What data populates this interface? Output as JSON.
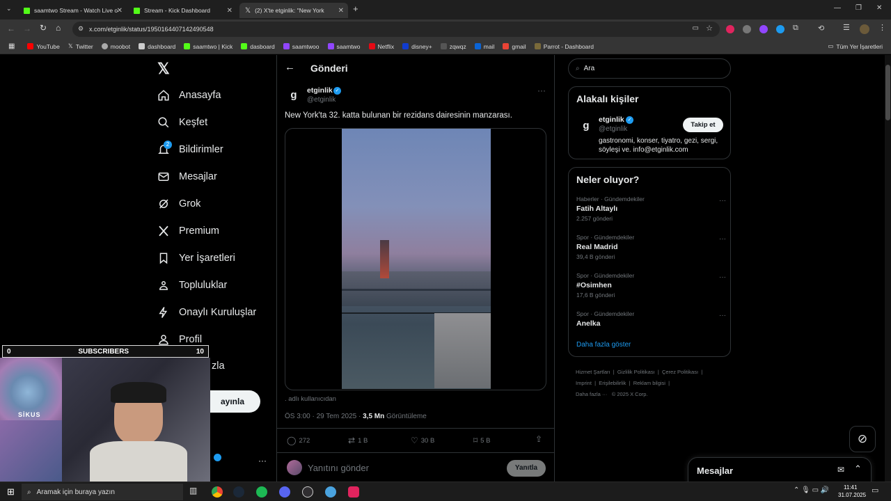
{
  "browser": {
    "tabs": [
      {
        "label": "saamtwo Stream - Watch Live o"
      },
      {
        "label": "Stream - Kick Dashboard"
      },
      {
        "label": "(2) X'te etginlik: \"New York"
      }
    ],
    "url": "x.com/etginlik/status/1950164407142490548",
    "bookmarks": [
      "YouTube",
      "Twitter",
      "moobot",
      "dashboard",
      "saamtwo | Kick",
      "dasboard",
      "saamtwoo",
      "saamtwo",
      "Netflix",
      "disney+",
      "zqwqz",
      "mail",
      "gmail",
      "Parrot - Dashboard"
    ],
    "all_bookmarks": "Tüm Yer İşaretleri"
  },
  "nav": {
    "items": [
      "Anasayfa",
      "Keşfet",
      "Bildirimler",
      "Mesajlar",
      "Grok",
      "Premium",
      "Yer İşaretleri",
      "Topluluklar",
      "Onaylı Kuruluşlar",
      "Profil",
      "zla"
    ],
    "notification_count": "2",
    "post_button": "ayınla"
  },
  "post": {
    "header_title": "Gönderi",
    "author_name": "etginlik",
    "author_handle": "@etginlik",
    "text": "New York'ta 32. katta bulunan bir rezidans dairesinin manzarası.",
    "source_note": ". adlı kullanıcıdan",
    "time": "ÖS 3:00 · 29 Tem 2025 · ",
    "views_count": "3,5 Mn",
    "views_label": " Görüntüleme",
    "replies": "272",
    "reposts": "1 B",
    "likes": "30 B",
    "bookmarks": "5 B",
    "reply_placeholder": "Yanıtını gönder",
    "reply_button": "Yanıtla"
  },
  "right": {
    "search_placeholder": "Ara",
    "related_title": "Alakalı kişiler",
    "related": {
      "name": "etginlik",
      "handle": "@etginlik",
      "bio": "gastronomi, konser, tiyatro, gezi, sergi, söyleşi ve. info@etginlik.com",
      "follow": "Takip et"
    },
    "trends_title": "Neler oluyor?",
    "trends": [
      {
        "context": "Haberler · Gündemdekiler",
        "name": "Fatih Altaylı",
        "count": "2.257 gönderi"
      },
      {
        "context": "Spor · Gündemdekiler",
        "name": "Real Madrid",
        "count": "39,4 B gönderi"
      },
      {
        "context": "Spor · Gündemdekiler",
        "name": "#Osimhen",
        "count": "17,6 B gönderi"
      },
      {
        "context": "Spor · Gündemdekiler",
        "name": "Anelka",
        "count": ""
      }
    ],
    "show_more": "Daha fazla göster",
    "footer": [
      "Hizmet Şartları",
      "Gizlilik Politikası",
      "Çerez Politikası",
      "Imprint",
      "Erişilebilirlik",
      "Reklam bilgisi",
      "Daha fazla ···",
      "© 2025 X Corp."
    ],
    "messages": "Mesajlar"
  },
  "overlay": {
    "sub_left": "0",
    "sub_title": "SUBSCRIBERS",
    "sub_right": "10",
    "bird_label": "SİKUS"
  },
  "taskbar": {
    "search": "Aramak için buraya yazın",
    "time": "11:41",
    "date": "31.07.2025"
  }
}
